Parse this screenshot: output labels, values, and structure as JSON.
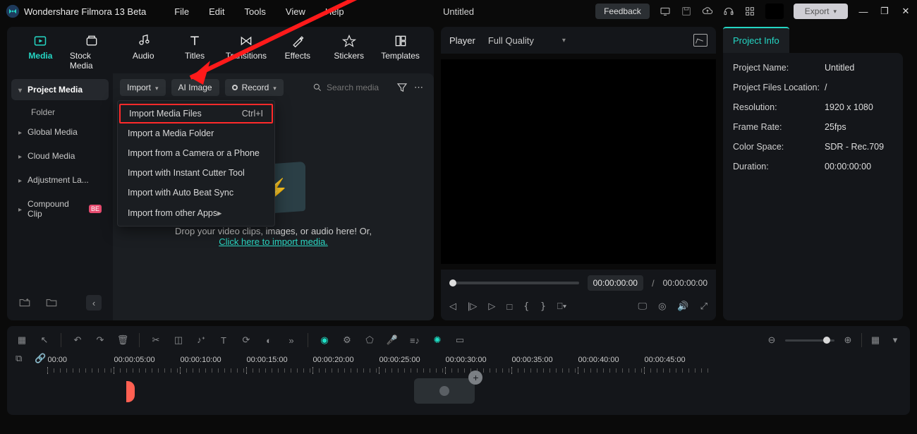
{
  "app": {
    "title": "Wondershare Filmora 13 Beta"
  },
  "menubar": [
    "File",
    "Edit",
    "Tools",
    "View",
    "Help"
  ],
  "document_title": "Untitled",
  "titlebar_buttons": {
    "feedback": "Feedback",
    "export": "Export"
  },
  "mode_tabs": [
    {
      "label": "Media",
      "active": true
    },
    {
      "label": "Stock Media"
    },
    {
      "label": "Audio"
    },
    {
      "label": "Titles"
    },
    {
      "label": "Transitions"
    },
    {
      "label": "Effects"
    },
    {
      "label": "Stickers"
    },
    {
      "label": "Templates"
    }
  ],
  "sidebar": {
    "items": [
      {
        "label": "Project Media",
        "active": true,
        "expanded": true
      },
      {
        "label": "Folder",
        "sub": true
      },
      {
        "label": "Global Media"
      },
      {
        "label": "Cloud Media"
      },
      {
        "label": "Adjustment La..."
      },
      {
        "label": "Compound Clip",
        "badge": "BE"
      }
    ]
  },
  "toolbar": {
    "import_label": "Import",
    "ai_image_label": "AI Image",
    "record_label": "Record",
    "search_placeholder": "Search media"
  },
  "import_menu": [
    {
      "label": "Import Media Files",
      "shortcut": "Ctrl+I",
      "highlighted": true
    },
    {
      "label": "Import a Media Folder"
    },
    {
      "label": "Import from a Camera or a Phone"
    },
    {
      "label": "Import with Instant Cutter Tool"
    },
    {
      "label": "Import with Auto Beat Sync"
    },
    {
      "label": "Import from other Apps",
      "submenu": true
    }
  ],
  "dropzone": {
    "line1": "Drop your video clips, images, or audio here! Or,",
    "link": "Click here to import media."
  },
  "player": {
    "tab": "Player",
    "quality": "Full Quality",
    "current": "00:00:00:00",
    "sep": "/",
    "total": "00:00:00:00"
  },
  "project_info": {
    "tab": "Project Info",
    "rows": [
      {
        "label": "Project Name:",
        "value": "Untitled"
      },
      {
        "label": "Project Files Location:",
        "value": "/"
      },
      {
        "label": "Resolution:",
        "value": "1920 x 1080"
      },
      {
        "label": "Frame Rate:",
        "value": "25fps"
      },
      {
        "label": "Color Space:",
        "value": "SDR - Rec.709"
      },
      {
        "label": "Duration:",
        "value": "00:00:00:00"
      }
    ]
  },
  "timeline": {
    "ticks": [
      "00:00",
      "00:00:05:00",
      "00:00:10:00",
      "00:00:15:00",
      "00:00:20:00",
      "00:00:25:00",
      "00:00:30:00",
      "00:00:35:00",
      "00:00:40:00",
      "00:00:45:00"
    ]
  }
}
